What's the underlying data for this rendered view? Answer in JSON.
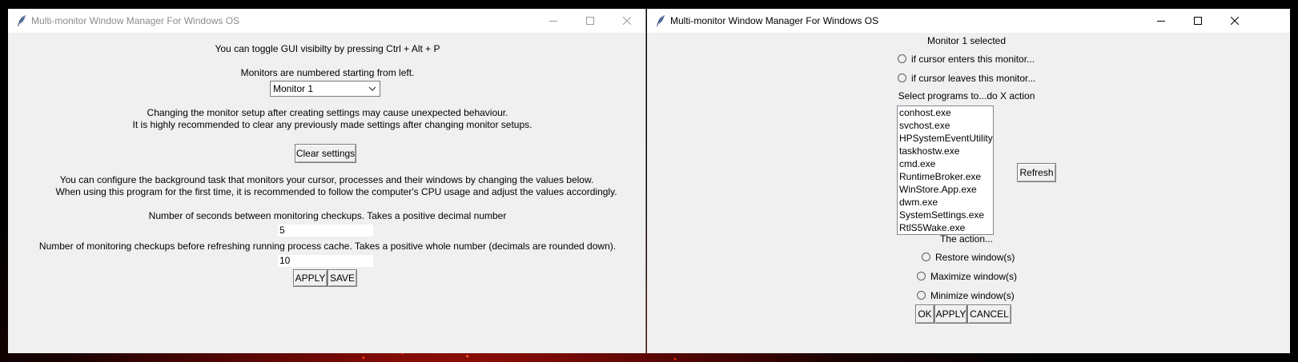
{
  "main_window": {
    "title": "Multi-monitor Window Manager For Windows OS",
    "toggle_info": "You can toggle GUI visibilty by pressing Ctrl + Alt + P",
    "monitors_info": "Monitors are numbered starting from left.",
    "monitor_select": {
      "selected": "Monitor 1"
    },
    "warning_line1": "Changing the monitor setup after creating settings may cause unexpected behaviour.",
    "warning_line2": "It is highly recommended to clear any previously made settings after changing monitor setups.",
    "clear_button": "Clear settings",
    "config_line1": "You can configure the background task that monitors your cursor, processes and their windows by changing the values below.",
    "config_line2": "When using this program for the first time, it is recommended to follow the computer's CPU usage and adjust the values accordingly.",
    "seconds_label": "Number of seconds between monitoring checkups. Takes a positive decimal number",
    "seconds_value": "5",
    "checkups_label": "Number of monitoring checkups before refreshing running process cache. Takes a positive whole number (decimals are rounded down).",
    "checkups_value": "10",
    "apply_button": "APPLY",
    "save_button": "SAVE"
  },
  "settings_window": {
    "title": "Multi-monitor Window Manager For Windows OS",
    "monitor_selected": "Monitor 1 selected",
    "trigger_options": [
      "if cursor enters this monitor...",
      "if cursor leaves this monitor..."
    ],
    "programs_label": "Select programs to...do X action",
    "programs": [
      "conhost.exe",
      "svchost.exe",
      "HPSystemEventUtilityHost.exe",
      "taskhostw.exe",
      "cmd.exe",
      "RuntimeBroker.exe",
      "WinStore.App.exe",
      "dwm.exe",
      "SystemSettings.exe",
      "RtlS5Wake.exe"
    ],
    "refresh_button": "Refresh",
    "action_label": "The action...",
    "action_options": [
      "Restore window(s)",
      "Maximize window(s)",
      "Minimize window(s)"
    ],
    "ok_button": "OK",
    "apply_button": "APPLY",
    "cancel_button": "CANCEL"
  }
}
